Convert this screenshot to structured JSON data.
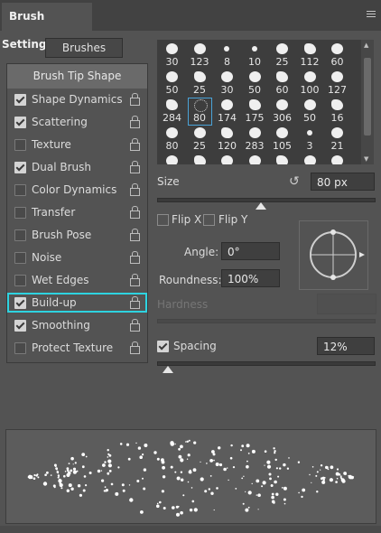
{
  "header": {
    "title": "Brush Settings",
    "menu_icon": "hamburger-menu-icon"
  },
  "brushes_button": "Brushes",
  "sidebar": {
    "tip_shape": "Brush Tip Shape",
    "items": [
      {
        "label": "Shape Dynamics",
        "checked": true,
        "lock": true
      },
      {
        "label": "Scattering",
        "checked": true,
        "lock": true
      },
      {
        "label": "Texture",
        "checked": false,
        "lock": true
      },
      {
        "label": "Dual Brush",
        "checked": true,
        "lock": true
      },
      {
        "label": "Color Dynamics",
        "checked": false,
        "lock": true
      },
      {
        "label": "Transfer",
        "checked": false,
        "lock": true
      },
      {
        "label": "Brush Pose",
        "checked": false,
        "lock": true
      },
      {
        "label": "Noise",
        "checked": false,
        "lock": true
      },
      {
        "label": "Wet Edges",
        "checked": false,
        "lock": true
      },
      {
        "label": "Build-up",
        "checked": true,
        "lock": true,
        "selected": true
      },
      {
        "label": "Smoothing",
        "checked": true,
        "lock": true
      },
      {
        "label": "Protect Texture",
        "checked": false,
        "lock": true
      }
    ]
  },
  "brush_grid": {
    "sizes": [
      "30",
      "123",
      "8",
      "10",
      "25",
      "112",
      "60",
      "50",
      "25",
      "30",
      "50",
      "60",
      "100",
      "127",
      "284",
      "80",
      "174",
      "175",
      "306",
      "50",
      "16",
      "80",
      "25",
      "120",
      "283",
      "105",
      "3",
      "21",
      "",
      "",
      "",
      "",
      "",
      "",
      ""
    ],
    "selected_index": 15
  },
  "size": {
    "label": "Size",
    "value": "80 px",
    "slider_fraction": 0.48,
    "reset_icon": "reset-icon"
  },
  "flip": {
    "x_label": "Flip X",
    "y_label": "Flip Y"
  },
  "angle": {
    "label": "Angle:",
    "value": "0°"
  },
  "roundness": {
    "label": "Roundness:",
    "value": "100%"
  },
  "hardness": {
    "label": "Hardness"
  },
  "spacing": {
    "label": "Spacing",
    "value": "12%",
    "checked": true,
    "slider_fraction": 0.05
  },
  "colors": {
    "accent": "#2ed3e0",
    "panel": "#535353",
    "field": "#3f3f3f"
  }
}
